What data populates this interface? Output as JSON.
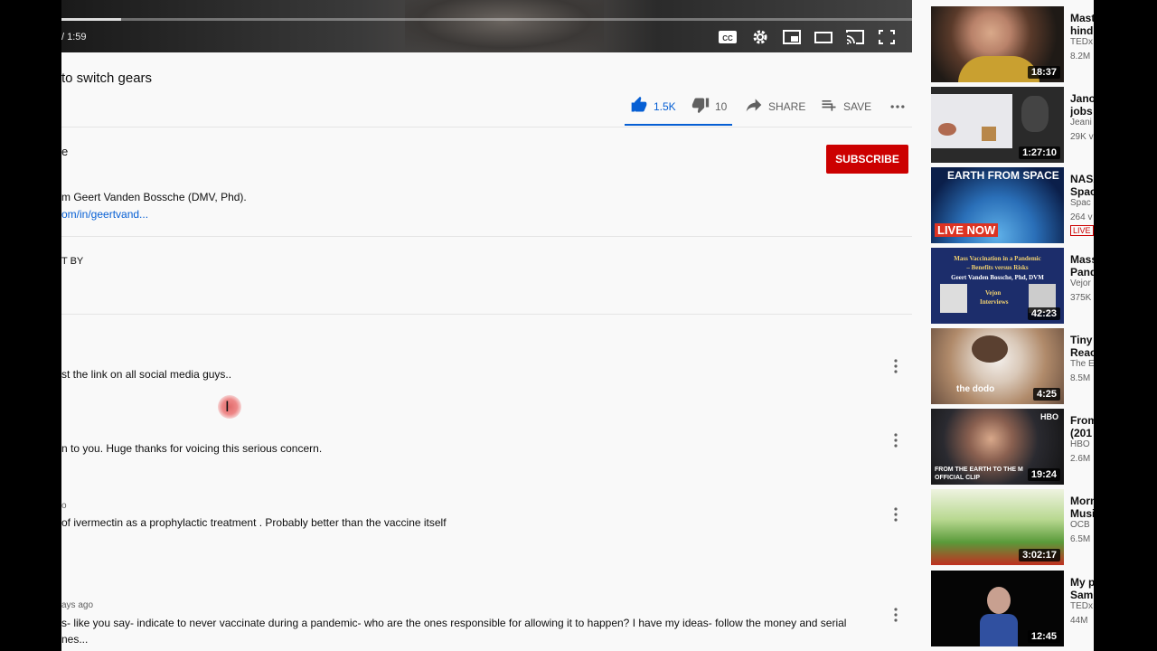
{
  "player": {
    "time_display": "/ 1:59",
    "progress": 0.07,
    "controls": [
      "cc-icon",
      "settings-gear-icon",
      "miniplayer-icon",
      "theater-mode-icon",
      "cast-icon",
      "fullscreen-icon"
    ]
  },
  "video": {
    "title": "to switch gears",
    "like_count": "1.5K",
    "dislike_count": "10",
    "share_label": "SHARE",
    "save_label": "SAVE"
  },
  "channel": {
    "name_fragment": "e",
    "subscribe_label": "SUBSCRIBE"
  },
  "description": {
    "line": "m Geert Vanden Bossche (DMV, Phd).",
    "link": "om/in/geertvand..."
  },
  "comments_header": {
    "sort_label": "T BY"
  },
  "comments": [
    {
      "meta": "",
      "text": "st the link on all social media guys.."
    },
    {
      "meta": "",
      "text": "n to you. Huge thanks for voicing this serious concern."
    },
    {
      "meta": "o",
      "text": "of ivermectin as a prophylactic treatment . Probably better than the vaccine itself"
    },
    {
      "meta": "ays ago",
      "text": "s- like you say- indicate to never vaccinate during a pandemic- who are the ones responsible for allowing it to happen? I have my ideas- follow the money and serial",
      "text2": "nes..."
    }
  ],
  "cursor": {
    "glyph": "I"
  },
  "recommendations": [
    {
      "title1": "Mast",
      "title2": "hindr",
      "channel": "TEDx",
      "views": "8.2M",
      "duration": "18:37"
    },
    {
      "title1": "Jano",
      "title2": "jobs",
      "channel": "Jeani",
      "views": "29K v",
      "duration": "1:27:10"
    },
    {
      "title1": "NASA",
      "title2": "Spac",
      "channel": "Spac",
      "views": "264 v",
      "live_badge": "LIVE",
      "thumb_text_top": "EARTH FROM SPACE",
      "thumb_text_bottom": "LIVE NOW"
    },
    {
      "title1": "Mass",
      "title2": "Pand",
      "channel": "Vejor",
      "views": "375K",
      "duration": "42:23",
      "thumb_lines": [
        "Mass Vaccination in a Pandemic",
        "– Benefits versus Risks",
        "Geert Vanden Bossche, Phd, DVM",
        "Vejon",
        "Interviews"
      ]
    },
    {
      "title1": "Tiny",
      "title2": "Reac",
      "channel": "The E",
      "views": "8.5M",
      "duration": "4:25",
      "thumb_text": "the dodo"
    },
    {
      "title1": "From",
      "title2": "(201",
      "channel": "HBO",
      "views": "2.6M",
      "duration": "19:24",
      "thumb_badge": "HBO",
      "thumb_text": "FROM THE EARTH TO THE M",
      "thumb_text2": "OFFICIAL CLIP"
    },
    {
      "title1": "Morn",
      "title2": "Musi",
      "channel": "OCB",
      "views": "6.5M",
      "duration": "3:02:17"
    },
    {
      "title1": "My p",
      "title2": "Sam",
      "channel": "TEDx",
      "views": "44M",
      "duration": "12:45"
    }
  ],
  "colors": {
    "accent": "#065fd4",
    "subscribe": "#cc0000",
    "live": "#cc0000"
  }
}
